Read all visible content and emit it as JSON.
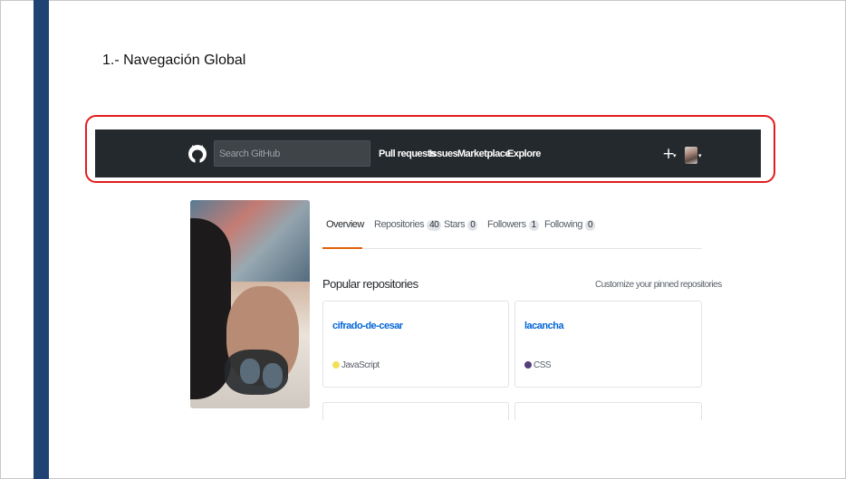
{
  "slide": {
    "title": "1.- Navegación Global"
  },
  "header": {
    "search": {
      "placeholder": "Search GitHub",
      "value": ""
    },
    "nav": [
      "Pull requests",
      "Issues",
      "Marketplace",
      "Explore"
    ],
    "plus_label": "+",
    "caret": "▾",
    "highlight_color": "#e31c1c",
    "background_color": "#24292e"
  },
  "profile": {
    "tabs": [
      {
        "label": "Overview",
        "count": null,
        "active": true
      },
      {
        "label": "Repositories",
        "count": "40",
        "active": false
      },
      {
        "label": "Stars",
        "count": "0",
        "active": false
      },
      {
        "label": "Followers",
        "count": "1",
        "active": false
      },
      {
        "label": "Following",
        "count": "0",
        "active": false
      }
    ],
    "accent_color": "#e36209",
    "popular_heading": "Popular repositories",
    "customize_link": "Customize your pinned repositories",
    "repos": [
      {
        "name": "cifrado-de-cesar",
        "language": "JavaScript",
        "language_color": "#f1e05a"
      },
      {
        "name": "lacancha",
        "language": "CSS",
        "language_color": "#563d7c"
      }
    ]
  },
  "icons": {
    "logo": "github-octocat-icon",
    "add": "plus-icon",
    "dropdown": "chevron-down-icon",
    "avatar": "user-avatar"
  }
}
